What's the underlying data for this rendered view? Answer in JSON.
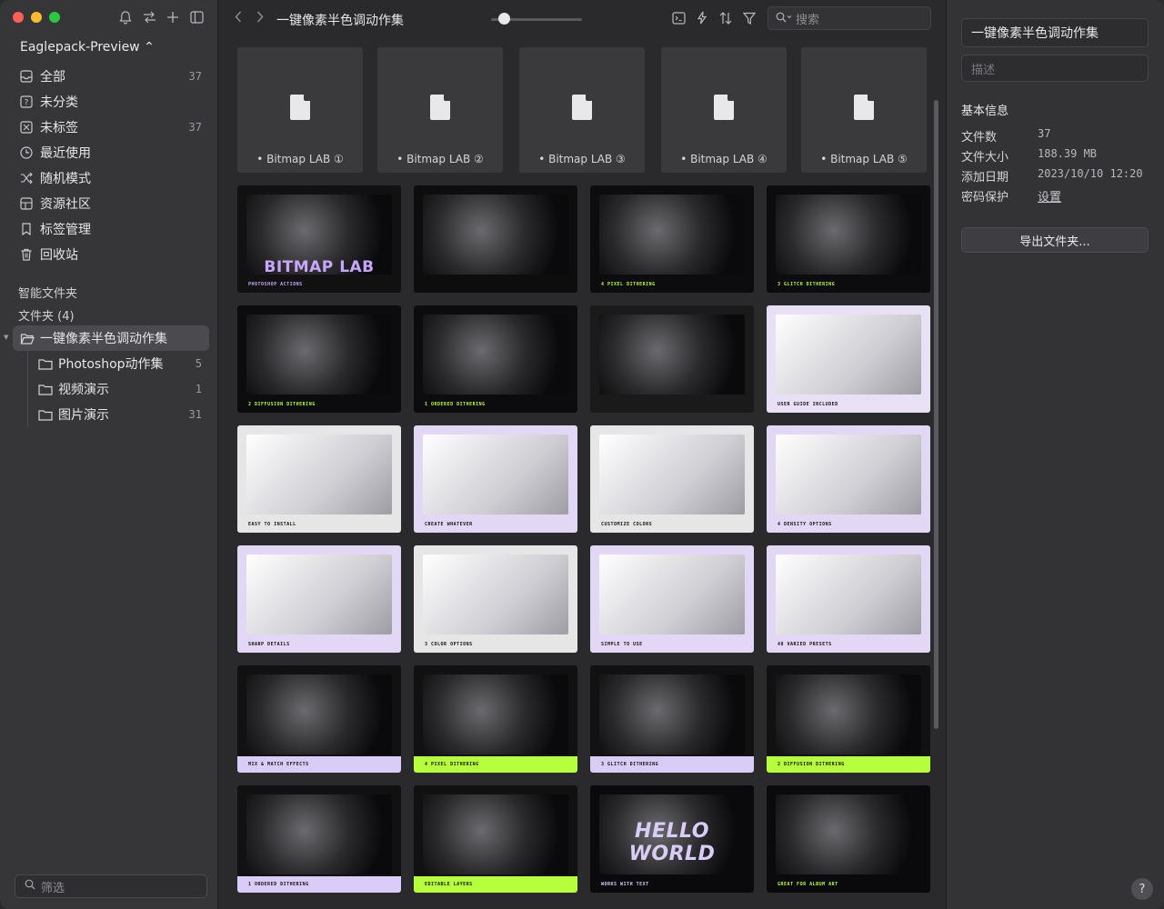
{
  "sidebar": {
    "library_name": "Eaglepack-Preview ⌃",
    "nav": [
      {
        "label": "全部",
        "count": "37",
        "icon": "inbox-icon"
      },
      {
        "label": "未分类",
        "count": "",
        "icon": "question-box-icon"
      },
      {
        "label": "未标签",
        "count": "37",
        "icon": "tag-box-icon"
      },
      {
        "label": "最近使用",
        "count": "",
        "icon": "clock-icon"
      },
      {
        "label": "随机模式",
        "count": "",
        "icon": "shuffle-icon"
      },
      {
        "label": "资源社区",
        "count": "",
        "icon": "grid-box-icon"
      },
      {
        "label": "标签管理",
        "count": "",
        "icon": "bookmark-icon"
      },
      {
        "label": "回收站",
        "count": "",
        "icon": "trash-icon"
      }
    ],
    "smart_folders": "智能文件夹",
    "folders_header": "文件夹 (4)",
    "folders": [
      {
        "label": "一键像素半色调动作集",
        "count": ""
      },
      {
        "label": "Photoshop动作集",
        "count": "5"
      },
      {
        "label": "视频演示",
        "count": "1"
      },
      {
        "label": "图片演示",
        "count": "31"
      }
    ],
    "filter_placeholder": "筛选"
  },
  "toolbar": {
    "title": "一键像素半色调动作集",
    "search_placeholder": "搜索"
  },
  "files": [
    {
      "label": "• Bitmap LAB ①"
    },
    {
      "label": "• Bitmap LAB ②"
    },
    {
      "label": "• Bitmap LAB ③"
    },
    {
      "label": "• Bitmap LAB ④"
    },
    {
      "label": "• Bitmap LAB ⑤"
    }
  ],
  "thumbnails": [
    {
      "caption": "PHOTOSHOP ACTIONS",
      "headline": "BITMAP LAB",
      "bg": "#111111",
      "fg": "#c8a6ff"
    },
    {
      "caption": "",
      "bg": "#0d0d0d",
      "fg": "#e0e0e0"
    },
    {
      "caption": "4 PIXEL DITHERING",
      "bg": "#0c0c0f",
      "fg": "#b7ff3c"
    },
    {
      "caption": "3 GLITCH DITHERING",
      "bg": "#0c0c0f",
      "fg": "#b7ff3c"
    },
    {
      "caption": "2 DIFFUSION DITHERING",
      "bg": "#0c0c0f",
      "fg": "#b7ff3c"
    },
    {
      "caption": "1 ORDERED DITHERING",
      "bg": "#0c0c0f",
      "fg": "#b7ff3c"
    },
    {
      "caption": "",
      "bg": "#1a1a1a",
      "fg": "#e0e0e0"
    },
    {
      "caption": "USER GUIDE INCLUDED",
      "bg": "#e8e0f5",
      "fg": "#111111"
    },
    {
      "caption": "EASY TO INSTALL",
      "bg": "#e6e6e6",
      "fg": "#111111"
    },
    {
      "caption": "CREATE WHATEVER",
      "bg": "#e2d8f6",
      "fg": "#111111"
    },
    {
      "caption": "CUSTOMIZE COLORS",
      "bg": "#e6e6e6",
      "fg": "#111111"
    },
    {
      "caption": "4 DENSITY OPTIONS",
      "bg": "#e2d8f6",
      "fg": "#111111"
    },
    {
      "caption": "SHARP DETAILS",
      "bg": "#e2d8f6",
      "fg": "#111111"
    },
    {
      "caption": "3 COLOR OPTIONS",
      "bg": "#e6e6e6",
      "fg": "#111111"
    },
    {
      "caption": "SIMPLE TO USE",
      "bg": "#e2d8f6",
      "fg": "#111111"
    },
    {
      "caption": "48 VARIED PRESETS",
      "bg": "#e2d8f6",
      "fg": "#111111"
    },
    {
      "caption": "MIX & MATCH EFFECTS",
      "bg": "#111111",
      "fg": "#111111",
      "band": "#d9ccf7"
    },
    {
      "caption": "4 PIXEL DITHERING",
      "bg": "#111111",
      "fg": "#111111",
      "band": "#b7ff3c"
    },
    {
      "caption": "3 GLITCH DITHERING",
      "bg": "#111111",
      "fg": "#111111",
      "band": "#d9ccf7"
    },
    {
      "caption": "2 DIFFUSION DITHERING",
      "bg": "#111111",
      "fg": "#111111",
      "band": "#b7ff3c"
    },
    {
      "caption": "1 ORDERED DITHERING",
      "bg": "#111111",
      "fg": "#111111",
      "band": "#d9ccf7"
    },
    {
      "caption": "EDITABLE LAYERS",
      "bg": "#111111",
      "fg": "#111111",
      "band": "#b7ff3c"
    },
    {
      "caption": "WORKS WITH TEXT",
      "headline": "HELLO WORLD",
      "bg": "#0a0a0c",
      "fg": "#d9ccf7"
    },
    {
      "caption": "GREAT FOR ALBUM ART",
      "bg": "#0a0a0c",
      "fg": "#b7ff3c"
    }
  ],
  "inspector": {
    "name": "一键像素半色调动作集",
    "desc_placeholder": "描述",
    "section": "基本信息",
    "rows": [
      {
        "k": "文件数",
        "v": "37"
      },
      {
        "k": "文件大小",
        "v": "188.39 MB"
      },
      {
        "k": "添加日期",
        "v": "2023/10/10 12:20"
      },
      {
        "k": "密码保护",
        "v": "设置"
      }
    ],
    "export_button": "导出文件夹...",
    "help": "?"
  }
}
